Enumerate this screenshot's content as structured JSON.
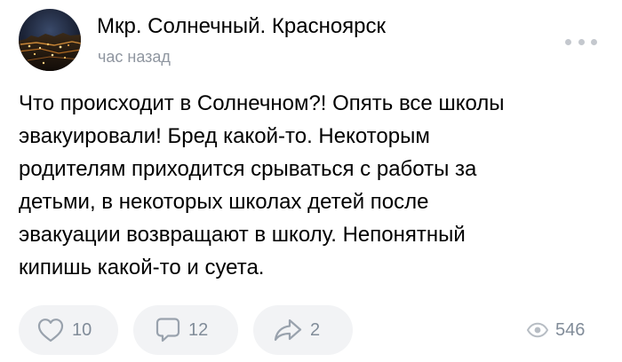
{
  "post": {
    "author": "Мкр. Солнечный. Красноярск",
    "timestamp": "час назад",
    "text_lines": [
      "Что происходит в Солнечном?! Опять все школы",
      "эвакуировали! Бред какой-то. Некоторым",
      "родителям приходится срываться с работы за",
      "детьми, в некоторых школах детей после",
      "эвакуации возвращают в школу. Непонятный",
      "кипишь какой-то и суета."
    ]
  },
  "actions": {
    "likes": "10",
    "comments": "12",
    "shares": "2",
    "views": "546"
  },
  "icons": {
    "more": "more-horizontal-icon",
    "like": "heart-icon",
    "comment": "comment-icon",
    "share": "share-icon",
    "views": "eye-icon"
  },
  "colors": {
    "text": "#000000",
    "secondary_text": "#8f96a0",
    "action_count": "#818c99",
    "action_background": "#f2f3f5",
    "icon": "#99a2ad"
  }
}
